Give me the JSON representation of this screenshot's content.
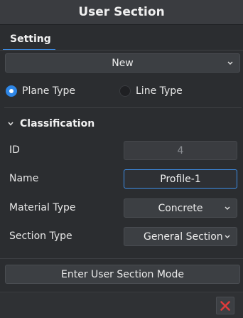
{
  "window": {
    "title": "User Section"
  },
  "tabs": [
    {
      "label": "Setting",
      "active": true
    }
  ],
  "preset": {
    "selected": "New"
  },
  "shape_type": {
    "options": [
      {
        "label": "Plane Type",
        "selected": true
      },
      {
        "label": "Line Type",
        "selected": false
      }
    ]
  },
  "classification": {
    "heading": "Classification",
    "id": {
      "label": "ID",
      "value": "4"
    },
    "name": {
      "label": "Name",
      "value": "Profile-1"
    },
    "material_type": {
      "label": "Material Type",
      "value": "Concrete"
    },
    "section_type": {
      "label": "Section Type",
      "value": "General Section"
    }
  },
  "actions": {
    "enter_mode_label": "Enter User Section Mode"
  },
  "colors": {
    "accent": "#2e86e6",
    "close": "#e03b3b",
    "background": "#2b2d30"
  },
  "icons": {
    "close": "close-x-icon",
    "dropdown": "chevron-down-icon",
    "section_toggle": "chevron-down-icon"
  }
}
